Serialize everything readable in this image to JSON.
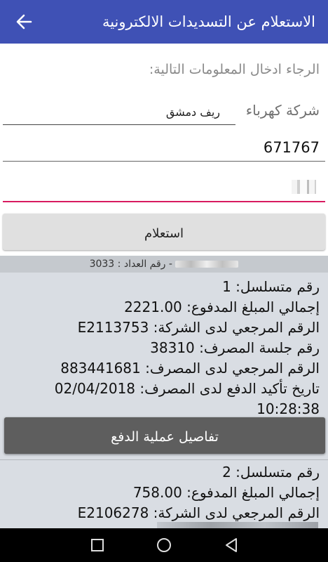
{
  "appbar": {
    "title": "الاستعلام عن التسديدات الالكترونية",
    "back_icon": "arrow-back-icon",
    "color": "#3f51b5"
  },
  "form": {
    "instruction": "الرجاء ادخال المعلومات التالية:",
    "company_label": "شركة كهرباء",
    "company_value": "ريف دمشق",
    "subscriber_number": "671767",
    "query_button": "استعلام"
  },
  "results": {
    "subheader_suffix": "- رقم العداد : 3033",
    "records": [
      {
        "serial": "رقم متسلسل: 1",
        "total": "إجمالي المبلغ المدفوع: 2221.00",
        "company_ref": "الرقم المرجعي لدى الشركة: E2113753",
        "bank_session": "رقم جلسة المصرف: 38310",
        "bank_ref": "الرقم المرجعي لدى المصرف: 883441681",
        "confirm_date": "تاريخ تأكيد الدفع لدى المصرف: 02/04/2018",
        "confirm_time": "10:28:38",
        "details_button": "تفاصيل عملية الدفع"
      },
      {
        "serial": "رقم متسلسل: 2",
        "total": "إجمالي المبلغ المدفوع: 758.00",
        "company_ref": "الرقم المرجعي لدى الشركة: E2106278"
      }
    ]
  },
  "navbar": {
    "square_icon": "recent-apps-icon",
    "circle_icon": "home-icon",
    "triangle_icon": "back-icon"
  }
}
